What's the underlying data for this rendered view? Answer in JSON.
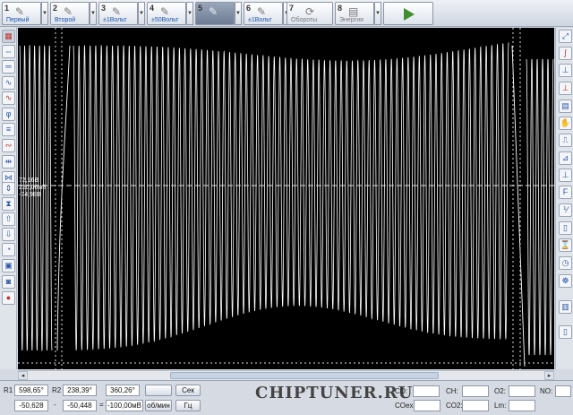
{
  "toolbar": {
    "channels": [
      {
        "num": "1",
        "label": "Первый",
        "icon": "probe-icon"
      },
      {
        "num": "2",
        "label": "Второй",
        "icon": "probe-icon"
      },
      {
        "num": "3",
        "label": "±1Вольт",
        "icon": "probe-icon"
      },
      {
        "num": "4",
        "label": "±50Вольт",
        "icon": "probe-icon"
      },
      {
        "num": "5",
        "label": "",
        "icon": "probe-icon"
      },
      {
        "num": "6",
        "label": "±1Вольт",
        "icon": "probe-icon"
      },
      {
        "num": "7",
        "label": "Обороты",
        "icon": "rotation-icon"
      },
      {
        "num": "8",
        "label": "Энергия",
        "icon": "energy-icon"
      }
    ],
    "active_channel": 5,
    "play_icon": "play-icon"
  },
  "plot": {
    "cursor_labels": [
      "72,16В",
      "220,00мВ",
      "-74,98В"
    ],
    "colors": {
      "background": "#000000",
      "trace": "#ffffff",
      "cursor": "#dddddd"
    }
  },
  "readout": {
    "r1_label": "R1",
    "r1_value": "598,65°",
    "r2_label": "R2",
    "r2_value": "238,39°",
    "angle_value": "360,26°",
    "sec_label": "Сек",
    "row2_left": "-50,628",
    "row2_minus": "-",
    "row2_mid": "-50,448",
    "row2_eq": "=",
    "row2_right": "-100,00мВ",
    "rpm_label": "об/мин",
    "hz_label": "Гц"
  },
  "brand": "CHIPTUNER.RU",
  "gas": {
    "co_label": "CO:",
    "ch_label": "CH:",
    "o2_label": "O2:",
    "no_label": "NO:",
    "coex_label": "COex:",
    "co2_label": "CO2:",
    "lm_label": "Lm:",
    "co_value": "",
    "ch_value": "",
    "o2_value": "",
    "no_value": "",
    "coex_value": "",
    "co2_value": "",
    "lm_value": ""
  }
}
